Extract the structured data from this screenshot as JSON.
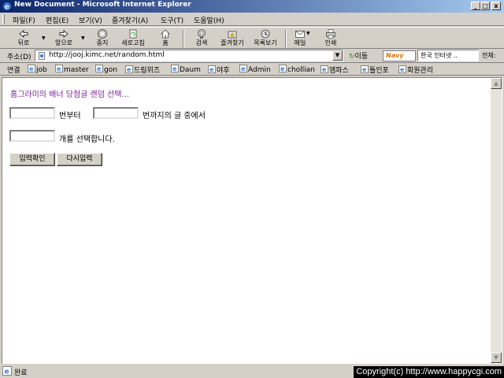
{
  "window": {
    "title": "New Document - Microsoft Internet Explorer",
    "minimize": "_",
    "maximize": "□",
    "close": "x"
  },
  "menu": [
    "파일(F)",
    "편집(E)",
    "보기(V)",
    "즐겨찾기(A)",
    "도구(T)",
    "도움말(H)"
  ],
  "toolbar": {
    "back": "뒤로",
    "forward": "앞으로",
    "stop": "중지",
    "refresh": "새로고침",
    "home": "홈",
    "search": "검색",
    "favorites": "즐겨찾기",
    "history": "목록보기",
    "mail": "메일",
    "print": "인쇄"
  },
  "address": {
    "label": "주소(D)",
    "url": "http://jooj.kimc.net/random.html",
    "go": "이동",
    "navy_logo": "Navy",
    "search_value": "한국 인터넷 ..",
    "search_scope": "전체:"
  },
  "links": {
    "label": "연결",
    "items": [
      "job",
      "master",
      "gon",
      "드림위즈",
      "Daum",
      "야후",
      "Admin",
      "chollian",
      "엠파스",
      "틀인포",
      "회원관리"
    ]
  },
  "page": {
    "heading": "홈그라미의 배너 당첨글 랜덤 선택...",
    "from_value": "",
    "from_suffix": "번부터",
    "to_value": "",
    "to_suffix": "번까지의 글 중에서",
    "count_value": "",
    "count_suffix": "개를 선택합니다.",
    "submit_label": "입력확인",
    "reset_label": "다시입력"
  },
  "status": {
    "text": "완료",
    "copyright": "Copyright(c) http://www.happycgi.com"
  },
  "colors": {
    "title_start": "#0a246a",
    "title_end": "#a6caf0",
    "heading": "#7a1fa0",
    "chrome": "#d4d0c8"
  }
}
